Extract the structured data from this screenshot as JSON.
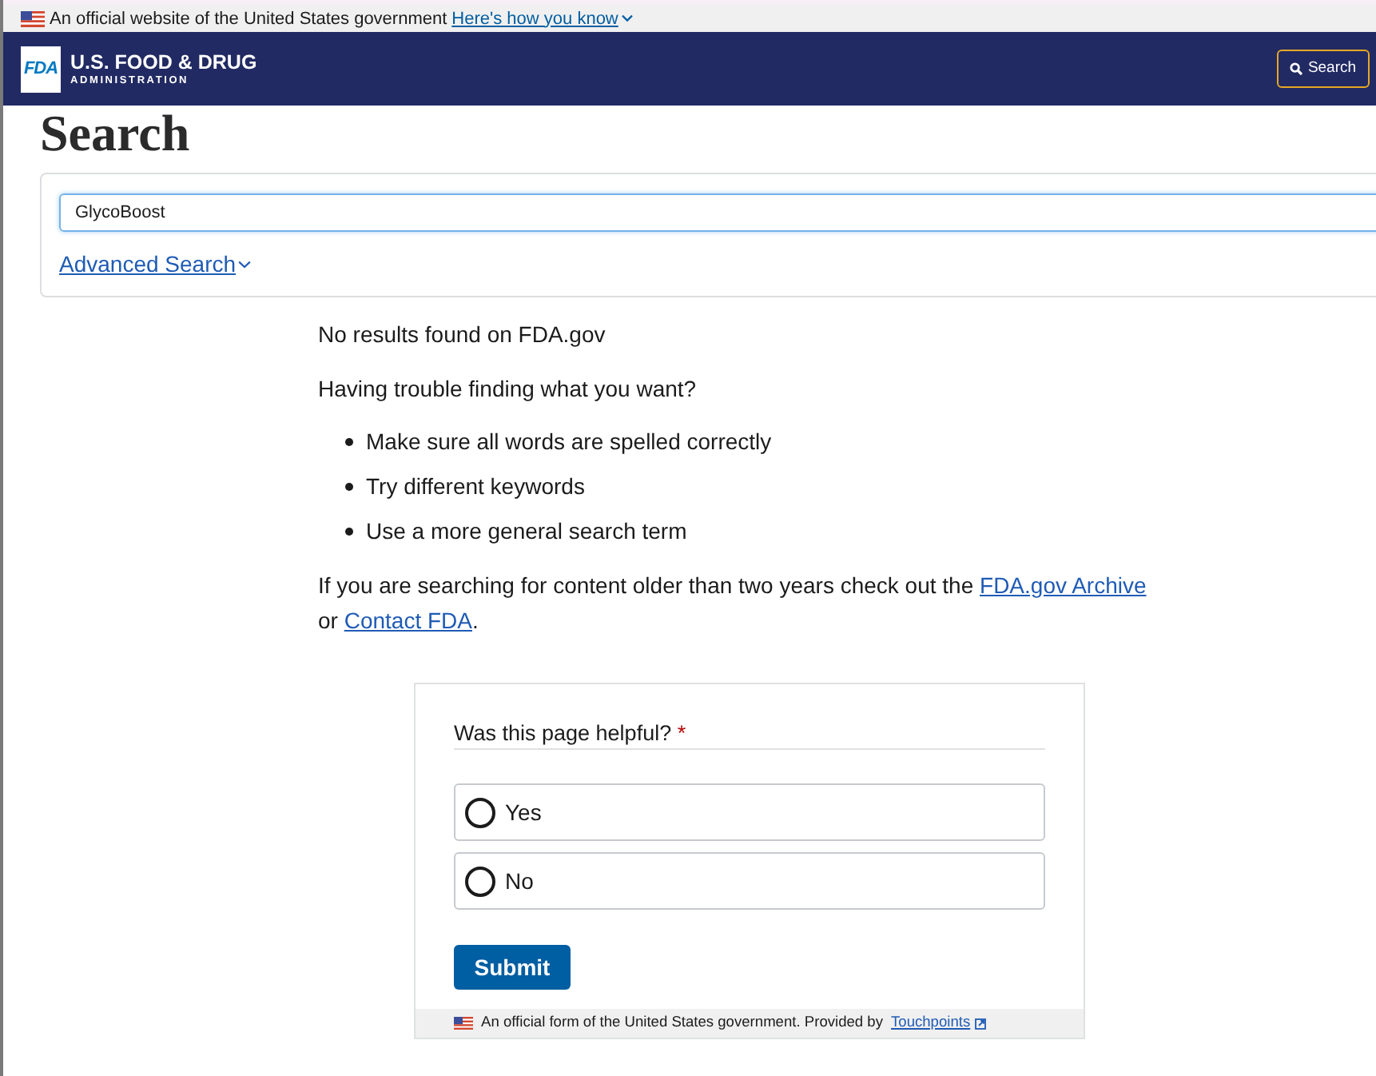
{
  "gov_banner": {
    "text": "An official website of the United States government",
    "link": "Here's how you know"
  },
  "header": {
    "logo": "FDA",
    "title": "U.S. FOOD & DRUG",
    "subtitle": "ADMINISTRATION",
    "search_button": "Search"
  },
  "page_title": "Search",
  "search": {
    "value": "GlycoBoost",
    "advanced_link": "Advanced Search"
  },
  "results": {
    "message": "No results found on FDA.gov",
    "help_heading": "Having trouble finding what you want?",
    "tips": [
      "Make sure all words are spelled correctly",
      "Try different keywords",
      "Use a more general search term"
    ],
    "archive_note": [
      {
        "kind": "text",
        "text": "If you are searching for content older than two years check out the "
      },
      {
        "kind": "link",
        "text": "FDA.gov Archive"
      },
      {
        "kind": "text",
        "text": " or "
      },
      {
        "kind": "link",
        "text": "Contact FDA"
      },
      {
        "kind": "text",
        "text": "."
      }
    ]
  },
  "feedback": {
    "question": "Was this page helpful?",
    "required_mark": "*",
    "options": [
      {
        "label": "Yes",
        "selected": false
      },
      {
        "label": "No",
        "selected": false
      }
    ],
    "submit": "Submit",
    "footer": {
      "text": "An official form of the United States government. Provided by",
      "link": "Touchpoints"
    }
  }
}
